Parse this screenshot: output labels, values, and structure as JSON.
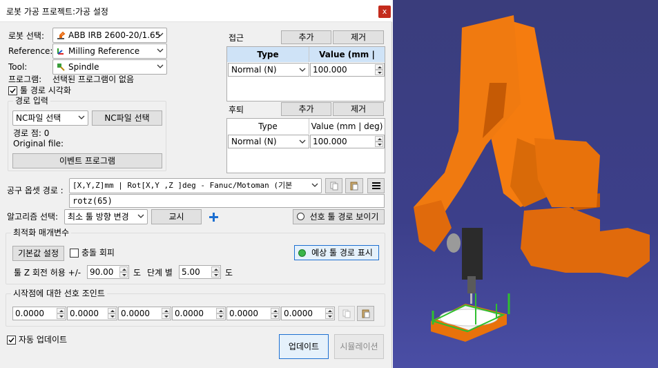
{
  "window": {
    "title": "로봇 가공 프로젝트:가공 설정",
    "close_label": "x"
  },
  "robot_select": {
    "label": "로봇 선택:",
    "value": "ABB IRB 2600-20/1.65"
  },
  "reference": {
    "label": "Reference:",
    "value": "Milling Reference"
  },
  "tool": {
    "label": "Tool:",
    "value": "Spindle"
  },
  "program": {
    "label": "프로그램:",
    "value": "선택된 프로그램이 없음"
  },
  "toolpath_visualize": {
    "label": "툴 경로 시각화",
    "checked": true
  },
  "path_input": {
    "group_title": "경로 입력",
    "nc_combo_value": "NC파일 선택",
    "nc_button": "NC파일 선택",
    "path_points": "경로 점: 0",
    "original_file": "Original file:",
    "event_button": "이벤트 프로그램"
  },
  "approach": {
    "label": "접근",
    "add": "추가",
    "remove": "제거",
    "col_type": "Type",
    "col_value": "Value (mm | deg)",
    "row_type": "Normal (N)",
    "row_value": "100.000"
  },
  "retract": {
    "label": "후퇴",
    "add": "추가",
    "remove": "제거",
    "col_type": "Type",
    "col_value": "Value (mm | deg)",
    "row_type": "Normal (N)",
    "row_value": "100.000"
  },
  "tool_offset": {
    "label": "공구 옵셋 경로 :",
    "combo_value": "[X,Y,Z]mm | Rot[X,Y ,Z  ]deg - Fanuc/Motoman (기본",
    "text_value": "rotz(65)"
  },
  "algorithm": {
    "label": "알고리즘 선택:",
    "value": "최소 툴 방향 변경",
    "teach_button": "교시",
    "preferred_path_button": "선호 툴 경로 보이기"
  },
  "optimization": {
    "group_title": "최적화 매개변수",
    "default_button": "기본값 설정",
    "collision_label": "충돌 회피",
    "collision_checked": false,
    "preview_button": "예상 툴 경로 표시",
    "z_rot_label": "툴 Z 회전 허용 +/-",
    "z_rot_value": "90.00",
    "deg_unit": "도",
    "step_label": "단계 별",
    "step_value": "5.00",
    "deg_unit2": "도"
  },
  "preferred_joints": {
    "group_title": "시작점에 대한 선호 조인트",
    "values": [
      "0.0000",
      "0.0000",
      "0.0000",
      "0.0000",
      "0.0000",
      "0.0000"
    ]
  },
  "auto_update": {
    "label": "자동 업데이트",
    "checked": true
  },
  "footer": {
    "update_button": "업데이트",
    "simulate_button": "시뮬레이션"
  },
  "colors": {
    "robot_orange": "#f57c0f",
    "viewport_bg": "#3c3f8a",
    "accent_blue": "#1c6fd1"
  }
}
